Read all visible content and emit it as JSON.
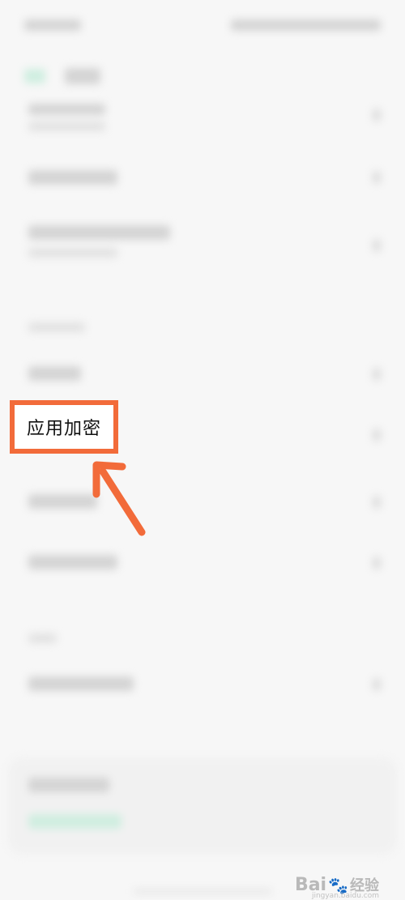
{
  "highlighted_item": {
    "label": "应用加密"
  },
  "watermark": {
    "brand": "Bai",
    "brand_suffix": "经验",
    "paw_icon": "paw-icon",
    "url": "jingyan.baidu.com"
  },
  "colors": {
    "highlight": "#f26b3a",
    "arrow": "#f26b3a",
    "accent_blurred": "#cfeee0"
  }
}
